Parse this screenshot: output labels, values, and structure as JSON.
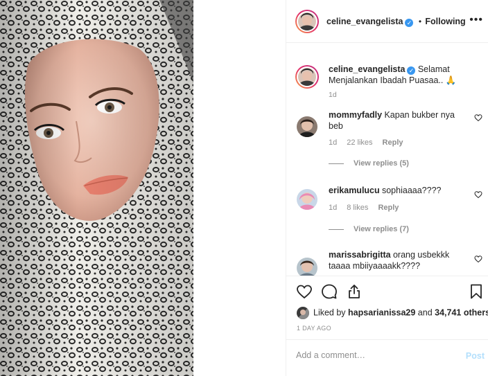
{
  "post": {
    "username": "celine_evangelista",
    "follow_separator": "•",
    "follow_status": "Following",
    "more_label": "•••",
    "verified_glyph": "✓"
  },
  "caption": {
    "username": "celine_evangelista",
    "text": "Selamat Menjalankan Ibadah Puasaa.. 🙏",
    "time": "1d"
  },
  "comments": [
    {
      "username": "mommyfadly",
      "text": "Kapan bukber nya beb",
      "time": "1d",
      "likes": "22 likes",
      "reply": "Reply",
      "view_replies": "View replies (5)"
    },
    {
      "username": "erikamulucu",
      "text": "sophiaaaa????",
      "time": "1d",
      "likes": "8 likes",
      "reply": "Reply",
      "view_replies": "View replies (7)"
    },
    {
      "username": "marissabrigitta",
      "text": "orang usbekkk taaaa mbiiyaaaakk????"
    }
  ],
  "likes": {
    "prefix": "Liked by ",
    "user": "hapsarianissa29",
    "middle": " and ",
    "count": "34,741 others"
  },
  "timestamp": "1 DAY AGO",
  "add_comment": {
    "placeholder": "Add a comment…",
    "post_label": "Post"
  },
  "icons": [
    "heart-icon",
    "comment-icon",
    "share-icon",
    "bookmark-icon",
    "verified-icon",
    "more-icon"
  ],
  "colors": {
    "verified": "#3897f0",
    "text": "#262626",
    "muted": "#8e8e8e",
    "post_disabled": "#b2dffc",
    "ring_start": "#f9a34a",
    "ring_end": "#c13584"
  }
}
